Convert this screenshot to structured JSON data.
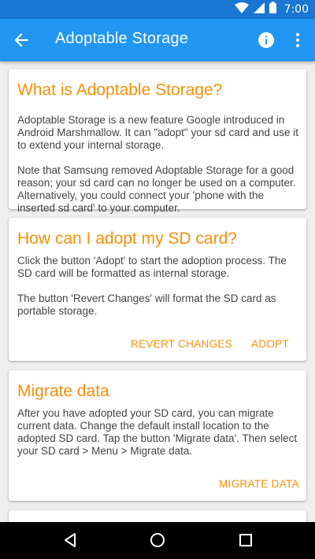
{
  "status_bar": {
    "time": "7:00"
  },
  "app_bar": {
    "title": "Adoptable Storage"
  },
  "cards": {
    "what_is": {
      "title": "What is Adoptable Storage?",
      "body1": "Adoptable Storage is a new feature Google introduced in Android Marshmallow. It can \"adopt\" your sd card and use it to extend your internal storage.",
      "body2": "Note that Samsung removed Adoptable Storage for a good reason; your sd card can no longer be used on a computer. Alternatively, you could connect your 'phone with the inserted sd card' to your computer."
    },
    "adopt": {
      "title": "How can I adopt my SD card?",
      "body1": "Click the button 'Adopt' to start the adoption process. The SD card will be formatted as internal storage.",
      "body2": "The button 'Revert Changes' will format the SD card as portable storage.",
      "revert_label": "REVERT CHANGES",
      "adopt_label": "ADOPT"
    },
    "migrate": {
      "title": "Migrate data",
      "body": "After you have adopted your SD card, you can migrate current data. Change the default install location to the adopted SD card. Tap the button 'Migrate data'. Then select your SD card > Menu > Migrate data.",
      "migrate_label": "MIGRATE DATA"
    }
  },
  "icons": {
    "status": [
      "wifi-icon",
      "signal-icon",
      "battery-icon"
    ],
    "app_bar": [
      "back-arrow-icon",
      "info-icon",
      "more-vert-icon"
    ],
    "navigation": [
      "back-triangle-icon",
      "home-circle-icon",
      "recents-square-icon"
    ]
  },
  "colors": {
    "primary": "#2196f3",
    "primary_dark": "#1976d2",
    "accent": "#f5900a",
    "background": "#eeeeee"
  }
}
